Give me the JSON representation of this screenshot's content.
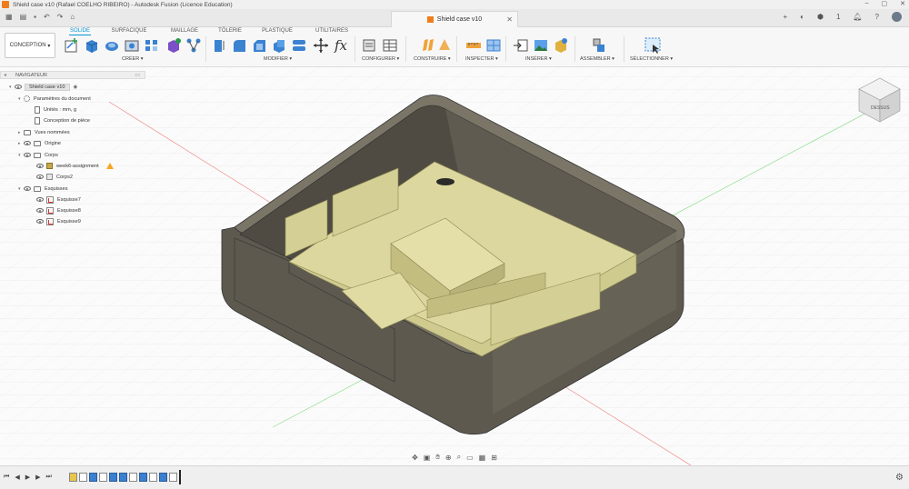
{
  "window": {
    "title": "Shield case v10 (Rafael COELHO RIBEIRO) - Autodesk Fusion (Licence Education)"
  },
  "document": {
    "tab_title": "Shield case v10"
  },
  "toolbar": {
    "workspace": "CONCEPTION",
    "tabs": [
      "SOLIDE",
      "SURFACIQUE",
      "MAILLAGE",
      "TÔLERIE",
      "PLASTIQUE",
      "UTILITAIRES"
    ],
    "active_tab": "SOLIDE",
    "groups": [
      "CRÉER",
      "MODIFIER",
      "CONFIGURER",
      "CONSTRUIRE",
      "INSPECTER",
      "INSÉRER",
      "ASSEMBLER",
      "SÉLECTIONNER"
    ]
  },
  "appbar": {
    "notification_count": "1"
  },
  "navigator": {
    "title": "NAVIGATEUR",
    "root": "Shield case v10",
    "items": [
      {
        "label": "Paramètres du document"
      },
      {
        "label": "Unités : mm, g"
      },
      {
        "label": "Conception de pièce"
      },
      {
        "label": "Vues nommées"
      },
      {
        "label": "Origine"
      },
      {
        "label": "Corps"
      },
      {
        "label": "week6-assignment"
      },
      {
        "label": "Corps2"
      },
      {
        "label": "Esquisses"
      },
      {
        "label": "Esquisse7"
      },
      {
        "label": "Esquisse8"
      },
      {
        "label": "Esquisse9"
      }
    ]
  },
  "viewcube": {
    "face_label": "DESSUS"
  },
  "colors": {
    "accent": "#0696d7",
    "part_fill": "#d9d49c",
    "case_fill": "#6b665a",
    "app_icon": "#f07d1a"
  }
}
